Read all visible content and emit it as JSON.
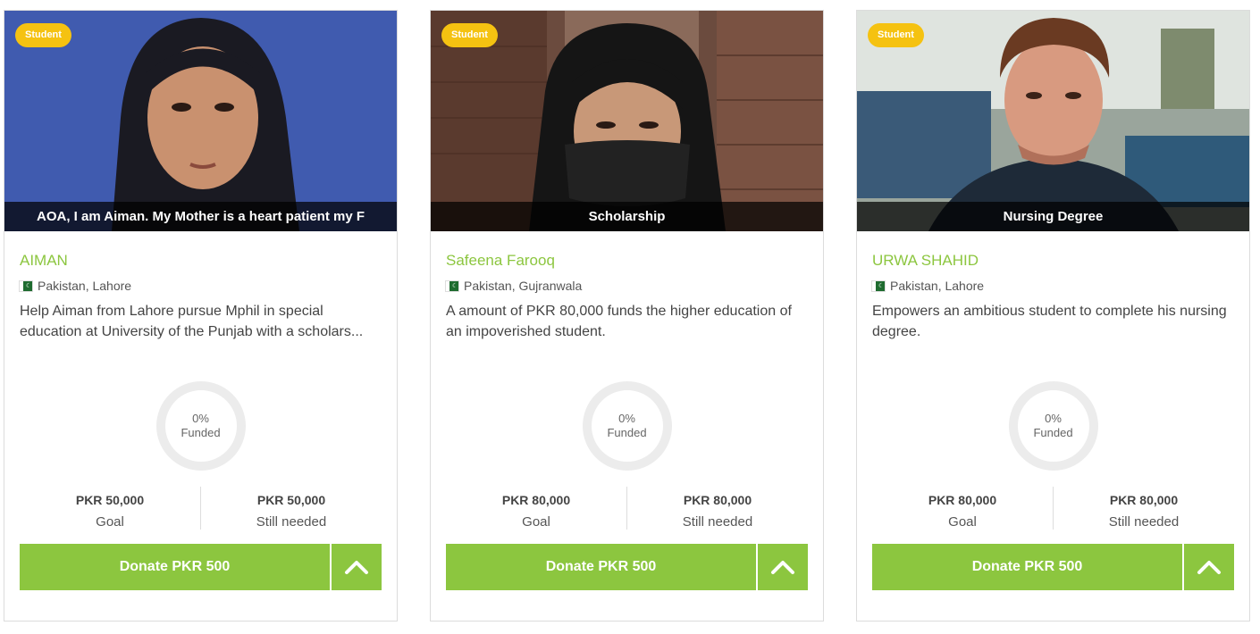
{
  "cards": [
    {
      "badge": "Student",
      "caption": "AOA, I am Aiman. My Mother is a heart patient my F",
      "name": "AIMAN",
      "location": "Pakistan, Lahore",
      "description": "Help Aiman from Lahore pursue Mphil in special education at University of the Punjab with a scholars...",
      "funded_percent": "0%",
      "funded_label": "Funded",
      "goal_amount": "PKR 50,000",
      "goal_label": "Goal",
      "needed_amount": "PKR 50,000",
      "needed_label": "Still needed",
      "donate_label": "Donate PKR 500"
    },
    {
      "badge": "Student",
      "caption": "Scholarship",
      "name": "Safeena Farooq",
      "location": "Pakistan, Gujranwala",
      "description": "A amount of PKR 80,000 funds the higher education of an impoverished student.",
      "funded_percent": "0%",
      "funded_label": "Funded",
      "goal_amount": "PKR 80,000",
      "goal_label": "Goal",
      "needed_amount": "PKR 80,000",
      "needed_label": "Still needed",
      "donate_label": "Donate PKR 500"
    },
    {
      "badge": "Student",
      "caption": "Nursing Degree",
      "name": "URWA SHAHID",
      "location": "Pakistan, Lahore",
      "description": "Empowers an ambitious student to complete his nursing degree.",
      "funded_percent": "0%",
      "funded_label": "Funded",
      "goal_amount": "PKR 80,000",
      "goal_label": "Goal",
      "needed_amount": "PKR 80,000",
      "needed_label": "Still needed",
      "donate_label": "Donate PKR 500"
    }
  ],
  "colors": {
    "accent_green": "#8cc63f",
    "badge_yellow": "#f5c211",
    "ring_gray": "#ececec"
  },
  "icons": {
    "flag": "pakistan-flag-icon",
    "toggle": "chevron-up-icon"
  }
}
